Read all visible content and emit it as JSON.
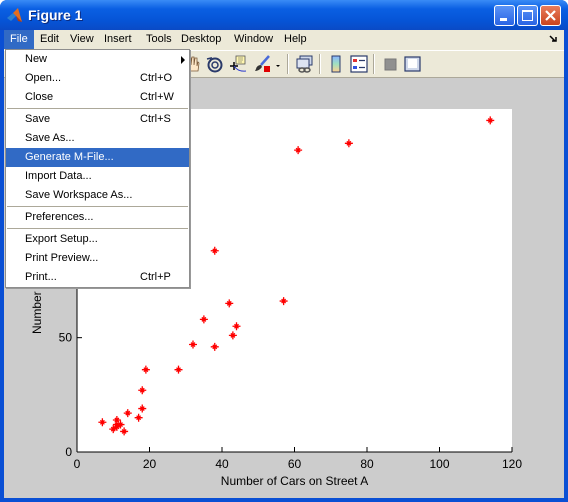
{
  "window": {
    "title": "Figure 1",
    "controls": [
      "minimize",
      "maximize",
      "close"
    ]
  },
  "menubar": {
    "items": [
      {
        "label": "File",
        "active": true
      },
      {
        "label": "Edit"
      },
      {
        "label": "View"
      },
      {
        "label": "Insert"
      },
      {
        "label": "Tools"
      },
      {
        "label": "Desktop"
      },
      {
        "label": "Window"
      },
      {
        "label": "Help"
      }
    ]
  },
  "toolbar": {
    "icons": [
      "pan-icon",
      "rotate-3d-icon",
      "data-cursor-icon",
      "brush-icon",
      "brush-dropdown-icon",
      "link-plot-icon",
      "colorbar-icon",
      "legend-icon",
      "hide-plot-tools-icon",
      "show-plot-tools-icon"
    ]
  },
  "file_menu": {
    "items": [
      {
        "label": "New",
        "shortcut": "",
        "submenu": true
      },
      {
        "label": "Open...",
        "shortcut": "Ctrl+O"
      },
      {
        "label": "Close",
        "shortcut": "Ctrl+W",
        "separator_after": true
      },
      {
        "label": "Save",
        "shortcut": "Ctrl+S"
      },
      {
        "label": "Save As...",
        "shortcut": ""
      },
      {
        "label": "Generate M-File...",
        "shortcut": "",
        "highlighted": true
      },
      {
        "label": "Import Data...",
        "shortcut": ""
      },
      {
        "label": "Save Workspace As...",
        "shortcut": "",
        "separator_after": true
      },
      {
        "label": "Preferences...",
        "shortcut": "",
        "separator_after": true
      },
      {
        "label": "Export Setup...",
        "shortcut": ""
      },
      {
        "label": "Print Preview...",
        "shortcut": ""
      },
      {
        "label": "Print...",
        "shortcut": "Ctrl+P"
      }
    ]
  },
  "chart_data": {
    "type": "scatter",
    "title": "",
    "xlabel": "Number of Cars on Street A",
    "ylabel": "Number of C",
    "xlim": [
      0,
      120
    ],
    "ylim": [
      0,
      150
    ],
    "xticks": [
      0,
      20,
      40,
      60,
      80,
      100,
      120
    ],
    "yticks": [
      0,
      50
    ],
    "grid": false,
    "marker": "*",
    "marker_color": "#ff0000",
    "points": [
      [
        7,
        13
      ],
      [
        11,
        14
      ],
      [
        10,
        10
      ],
      [
        11,
        12
      ],
      [
        12,
        12
      ],
      [
        13,
        9
      ],
      [
        11,
        11
      ],
      [
        14,
        17
      ],
      [
        17,
        15
      ],
      [
        18,
        19
      ],
      [
        18,
        27
      ],
      [
        19,
        36
      ],
      [
        28,
        36
      ],
      [
        32,
        47
      ],
      [
        35,
        58
      ],
      [
        38,
        46
      ],
      [
        43,
        51
      ],
      [
        44,
        55
      ],
      [
        42,
        65
      ],
      [
        38,
        88
      ],
      [
        57,
        66
      ],
      [
        61,
        132
      ],
      [
        75,
        135
      ],
      [
        114,
        145
      ]
    ]
  }
}
